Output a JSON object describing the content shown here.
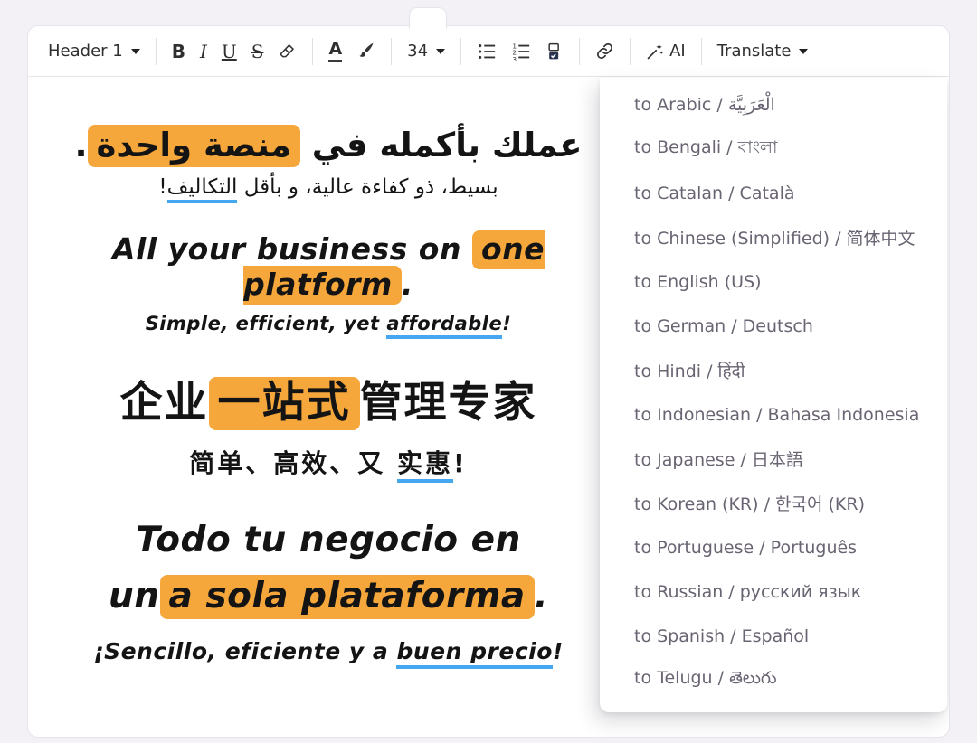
{
  "colors": {
    "highlight_orange": "#F6A73B",
    "underline_blue": "#45A7EF",
    "font_color_bar": "#3b3b3b",
    "checklist_fill": "#27334d"
  },
  "toolbar": {
    "heading": "Header 1",
    "bold_label": "B",
    "italic_label": "I",
    "underline_label": "U",
    "strikethrough_label": "S",
    "font_color_label": "A",
    "font_size": "34",
    "ai_label": "AI",
    "translate_label": "Translate"
  },
  "translate_menu": {
    "items": [
      "to Arabic / الْعَرَبِيَّة",
      "to Bengali / বাংলা",
      "to Catalan / Català",
      "to Chinese (Simplified) / 简体中文",
      "to English (US)",
      "to German / Deutsch",
      "to Hindi / हिंदी",
      "to Indonesian / Bahasa Indonesia",
      "to Japanese / 日本語",
      "to Korean (KR) / 한국어 (KR)",
      "to Portuguese / Português",
      "to Russian / русский язык",
      "to Spanish / Español",
      "to Telugu / తెలుగు"
    ]
  },
  "document": {
    "arabic": {
      "title_pre": "عملك بأكمله في ",
      "title_highlight": "منصة واحدة",
      "title_post": ".",
      "subtitle_pre": "بسيط، ذو كفاءة عالية، و بأقل ",
      "subtitle_underline": "التكاليف",
      "subtitle_post": "!"
    },
    "english": {
      "title_pre": "All your business on ",
      "title_highlight": "one platform",
      "title_post": ".",
      "subtitle_pre": "Simple, efficient, yet ",
      "subtitle_underline": "affordable",
      "subtitle_post": "!"
    },
    "chinese": {
      "title_pre": "企业",
      "title_highlight": "一站式",
      "title_post": "管理专家",
      "subtitle_pre": "简单、高效、又 ",
      "subtitle_underline": "实惠",
      "subtitle_post": "!"
    },
    "spanish": {
      "title_line1": "Todo tu negocio en",
      "title_line2_pre": "un",
      "title_line2_highlight": "a sola plataforma",
      "title_line2_post": ".",
      "subtitle_pre": "¡Sencillo, eficiente y a ",
      "subtitle_underline": "buen precio",
      "subtitle_post": "!"
    }
  }
}
